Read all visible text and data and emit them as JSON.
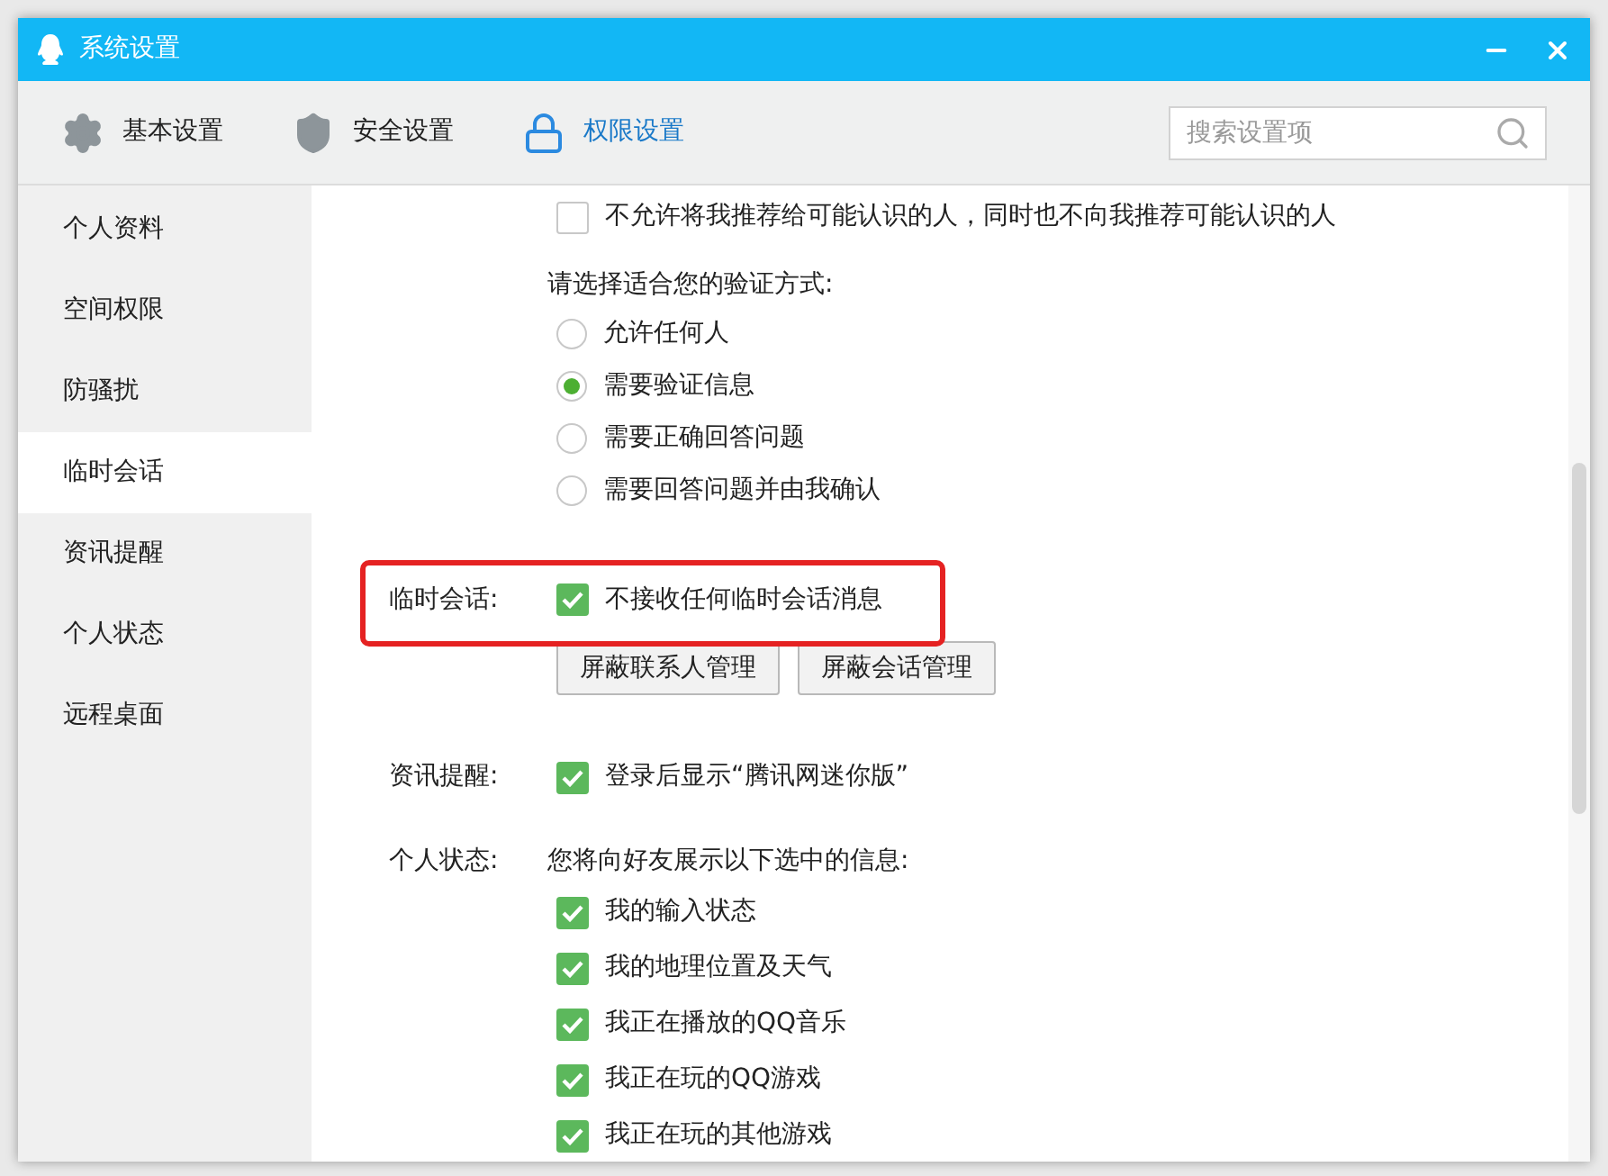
{
  "window": {
    "title": "系统设置"
  },
  "tabs": [
    {
      "label": "基本设置",
      "kind": "gear",
      "selected": false
    },
    {
      "label": "安全设置",
      "kind": "shield",
      "selected": false
    },
    {
      "label": "权限设置",
      "kind": "lock",
      "selected": true
    }
  ],
  "search": {
    "placeholder": "搜索设置项"
  },
  "sidebar": {
    "items": [
      {
        "label": "个人资料",
        "selected": false
      },
      {
        "label": "空间权限",
        "selected": false
      },
      {
        "label": "防骚扰",
        "selected": false
      },
      {
        "label": "临时会话",
        "selected": true
      },
      {
        "label": "资讯提醒",
        "selected": false
      },
      {
        "label": "个人状态",
        "selected": false
      },
      {
        "label": "远程桌面",
        "selected": false
      }
    ]
  },
  "recommend": {
    "label": "不允许将我推荐给可能认识的人，同时也不向我推荐可能认识的人",
    "checked": false
  },
  "verification": {
    "prompt": "请选择适合您的验证方式:",
    "options": [
      {
        "label": "允许任何人",
        "selected": false
      },
      {
        "label": "需要验证信息",
        "selected": true
      },
      {
        "label": "需要正确回答问题",
        "selected": false
      },
      {
        "label": "需要回答问题并由我确认",
        "selected": false
      }
    ]
  },
  "temp_chat": {
    "label": "临时会话:",
    "checkbox": {
      "label": "不接收任何临时会话消息",
      "checked": true
    },
    "buttons": [
      "屏蔽联系人管理",
      "屏蔽会话管理"
    ]
  },
  "news": {
    "label": "资讯提醒:",
    "checkbox": {
      "label": "登录后显示“腾讯网迷你版”",
      "checked": true
    }
  },
  "status": {
    "label": "个人状态:",
    "prompt": "您将向好友展示以下选中的信息:",
    "options": [
      {
        "label": "我的输入状态",
        "checked": true
      },
      {
        "label": "我的地理位置及天气",
        "checked": true
      },
      {
        "label": "我正在播放的QQ音乐",
        "checked": true
      },
      {
        "label": "我正在玩的QQ游戏",
        "checked": true
      },
      {
        "label": "我正在玩的其他游戏",
        "checked": true
      }
    ]
  }
}
